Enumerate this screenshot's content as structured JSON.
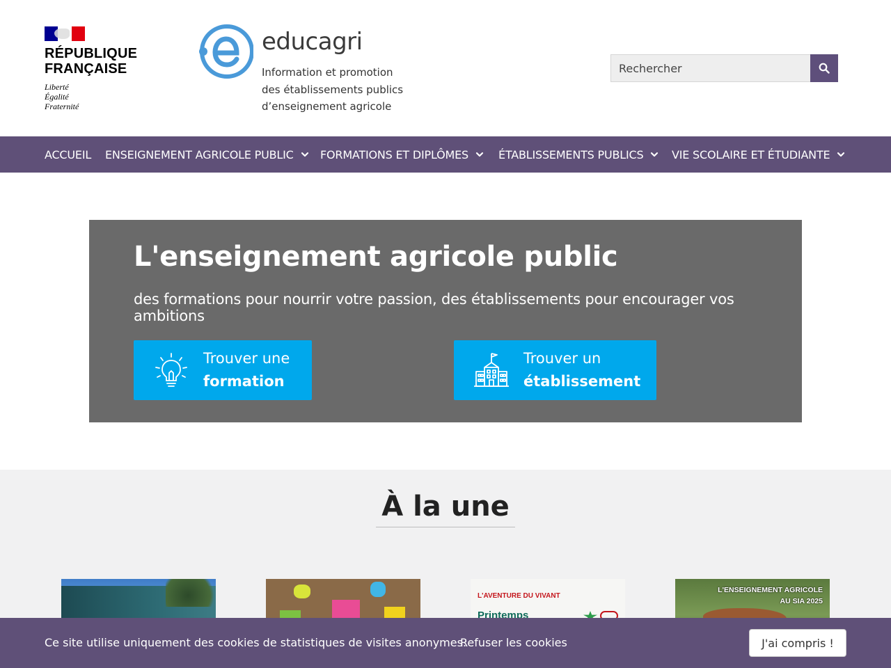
{
  "header": {
    "rf_logo": {
      "title_line1": "RÉPUBLIQUE",
      "title_line2": "FRANÇAISE",
      "motto": [
        "Liberté",
        "Égalité",
        "Fraternité"
      ]
    },
    "site_logo": {
      "name": "educagri",
      "tagline": [
        "Information et promotion",
        "des établissements publics",
        "d’enseignement agricole"
      ],
      "color": "#4a9ad9"
    },
    "search": {
      "placeholder": "Rechercher",
      "value": "",
      "icon": "search-icon"
    }
  },
  "nav": {
    "background": "#5f5078",
    "items": [
      {
        "label": "ACCUEIL",
        "has_dropdown": false
      },
      {
        "label": "ENSEIGNEMENT AGRICOLE PUBLIC",
        "has_dropdown": true
      },
      {
        "label": "FORMATIONS ET DIPLÔMES",
        "has_dropdown": true
      },
      {
        "label": "ÉTABLISSEMENTS PUBLICS",
        "has_dropdown": true
      },
      {
        "label": "VIE SCOLAIRE ET ÉTUDIANTE",
        "has_dropdown": true
      }
    ]
  },
  "hero": {
    "title": "L'enseignement agricole public",
    "subtitle": "des formations pour nourrir votre passion, des établissements pour encourager vos ambitions",
    "background": "#6a6a6a",
    "cta_color": "#00a8ec",
    "cta": [
      {
        "line1": "Trouver une",
        "line2": "formation",
        "icon": "lightbulb-icon"
      },
      {
        "line1": "Trouver un",
        "line2": "établissement",
        "icon": "school-building-icon"
      }
    ]
  },
  "une": {
    "title": "À la une",
    "cards": [
      {
        "image_text": ""
      },
      {
        "image_text": ""
      },
      {
        "image_text_line1": "L'AVENTURE DU VIVANT",
        "image_text_line2": "Printemps"
      },
      {
        "image_text_line1": "L'ENSEIGNEMENT AGRICOLE",
        "image_text_line2": "AU SIA 2025"
      }
    ]
  },
  "cookie_bar": {
    "message": "Ce site utilise uniquement des cookies de statistiques de visites anonymes.",
    "refuse_label": "Refuser les cookies",
    "accept_label": "J'ai compris !"
  }
}
